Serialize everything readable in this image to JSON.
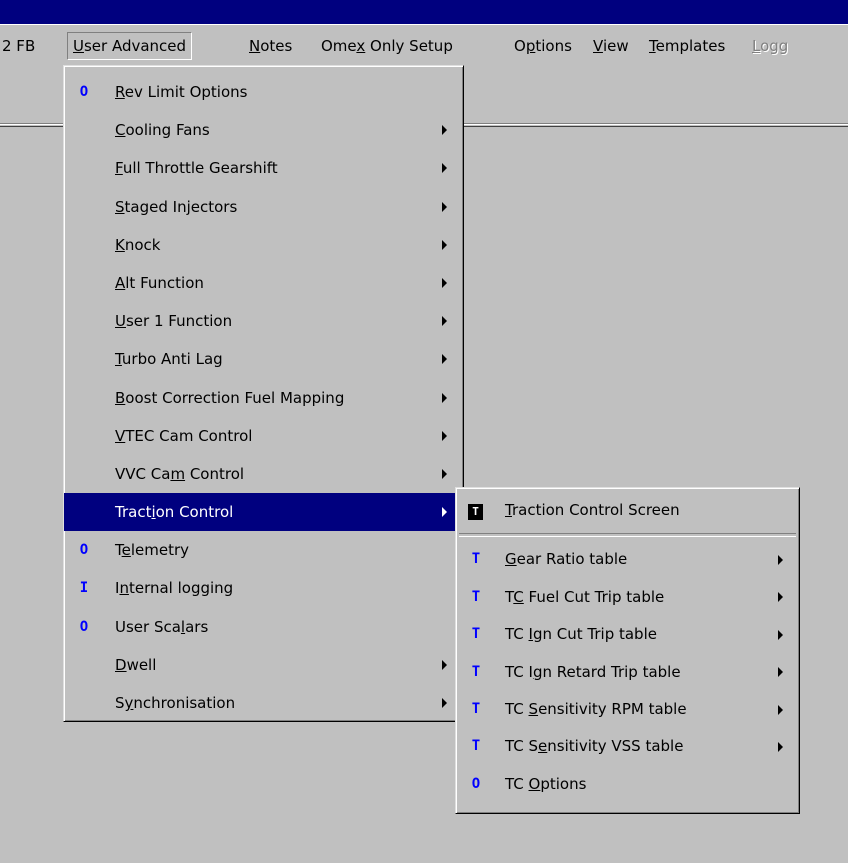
{
  "menubar": [
    {
      "label": "2 FB",
      "acc": ""
    },
    {
      "label": "User Advanced",
      "acc": "U",
      "active": true
    },
    {
      "label": "Notes",
      "acc": "N"
    },
    {
      "label": "Omex Only Setup",
      "acc": "x"
    },
    {
      "label": "Options",
      "acc": "p"
    },
    {
      "label": "View",
      "acc": "V"
    },
    {
      "label": "Templates",
      "acc": "T"
    },
    {
      "label": "Logg",
      "acc": "L",
      "disabled": true
    }
  ],
  "main_menu": [
    {
      "label": "Rev Limit Options",
      "acc": "R",
      "indicator": "O",
      "submenu": false
    },
    {
      "label": "Cooling Fans",
      "acc": "C",
      "indicator": "",
      "submenu": true
    },
    {
      "label": "Full Throttle Gearshift",
      "acc": "F",
      "indicator": "",
      "submenu": true
    },
    {
      "label": "Staged Injectors",
      "acc": "S",
      "indicator": "",
      "submenu": true
    },
    {
      "label": "Knock",
      "acc": "K",
      "indicator": "",
      "submenu": true
    },
    {
      "label": "Alt Function",
      "acc": "A",
      "indicator": "",
      "submenu": true
    },
    {
      "label": "User 1 Function",
      "acc": "U",
      "indicator": "",
      "submenu": true
    },
    {
      "label": "Turbo Anti Lag",
      "acc": "T",
      "indicator": "",
      "submenu": true
    },
    {
      "label": "Boost Correction Fuel Mapping",
      "acc": "B",
      "indicator": "",
      "submenu": true
    },
    {
      "label": "VTEC Cam Control",
      "acc": "V",
      "indicator": "",
      "submenu": true
    },
    {
      "label": "VVC Cam Control",
      "acc": "m",
      "indicator": "",
      "submenu": true
    },
    {
      "label": "Traction Control",
      "acc": "i",
      "indicator": "",
      "submenu": true,
      "highlighted": true
    },
    {
      "label": "Telemetry",
      "acc": "e",
      "indicator": "O",
      "submenu": false
    },
    {
      "label": "Internal logging",
      "acc": "n",
      "indicator": "I",
      "submenu": false
    },
    {
      "label": "User Scalars",
      "acc": "l",
      "indicator": "O",
      "submenu": false
    },
    {
      "label": "Dwell",
      "acc": "D",
      "indicator": "",
      "submenu": true
    },
    {
      "label": "Synchronisation",
      "acc": "y",
      "indicator": "",
      "submenu": true
    }
  ],
  "sub_menu": [
    {
      "label": "Traction Control Screen",
      "acc": "T",
      "indicator": "T",
      "box": true,
      "submenu": false
    },
    {
      "separator": true
    },
    {
      "label": "Gear Ratio table",
      "acc": "G",
      "indicator": "T",
      "submenu": true
    },
    {
      "label": "TC Fuel Cut Trip table",
      "acc": "C",
      "indicator": "T",
      "submenu": true
    },
    {
      "label": "TC Ign Cut Trip table",
      "acc": "I",
      "indicator": "T",
      "submenu": true
    },
    {
      "label": "TC Ign Retard Trip table",
      "acc": "g",
      "indicator": "T",
      "submenu": true
    },
    {
      "label": "TC Sensitivity RPM table",
      "acc": "S",
      "indicator": "T",
      "submenu": true
    },
    {
      "label": "TC Sensitivity VSS table",
      "acc": "e",
      "indicator": "T",
      "submenu": true
    },
    {
      "label": "TC Options",
      "acc": "O",
      "indicator": "O",
      "submenu": false
    }
  ],
  "colors": {
    "face": "#c0c0c0",
    "titlebar": "#00007f",
    "highlight": "#00007f",
    "indicator": "#0000ff"
  }
}
